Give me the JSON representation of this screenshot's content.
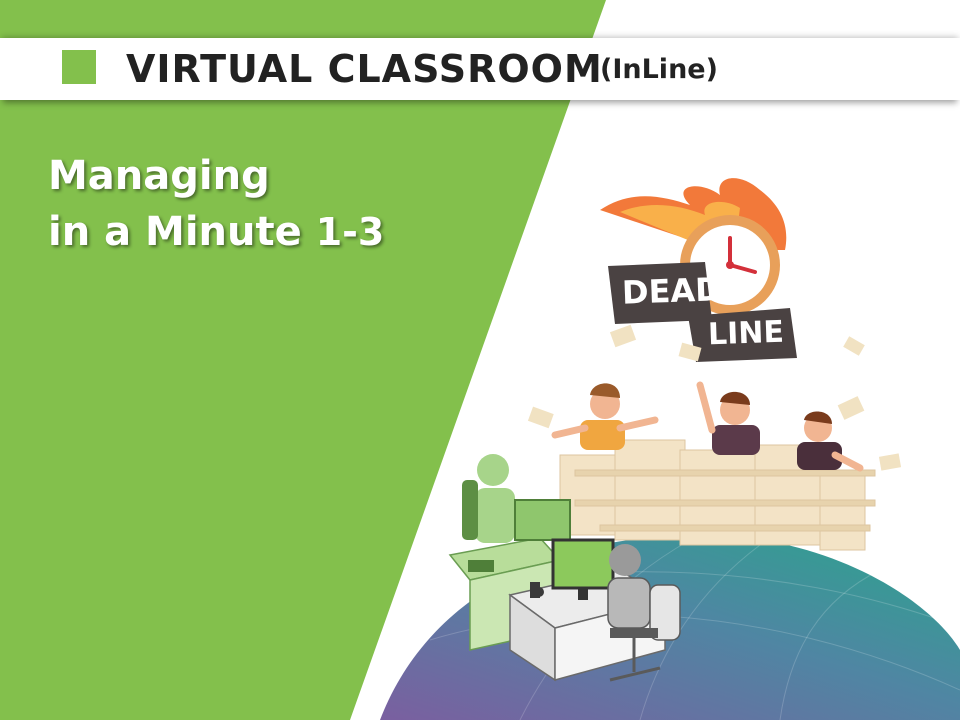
{
  "header": {
    "title": "VIRTUAL CLASSROOM",
    "subtitle": "(InLine)"
  },
  "course": {
    "line1": "Managing",
    "line2": "in a Minute",
    "number": "1-3"
  },
  "illustration": {
    "sign_line1": "DEAD",
    "sign_line2": "LINE"
  },
  "colors": {
    "brand_green": "#83c04c",
    "header_bg": "#ffffff",
    "text_dark": "#222222",
    "globe_teal": "#2e9e8f",
    "globe_purple": "#7a5fa0"
  }
}
